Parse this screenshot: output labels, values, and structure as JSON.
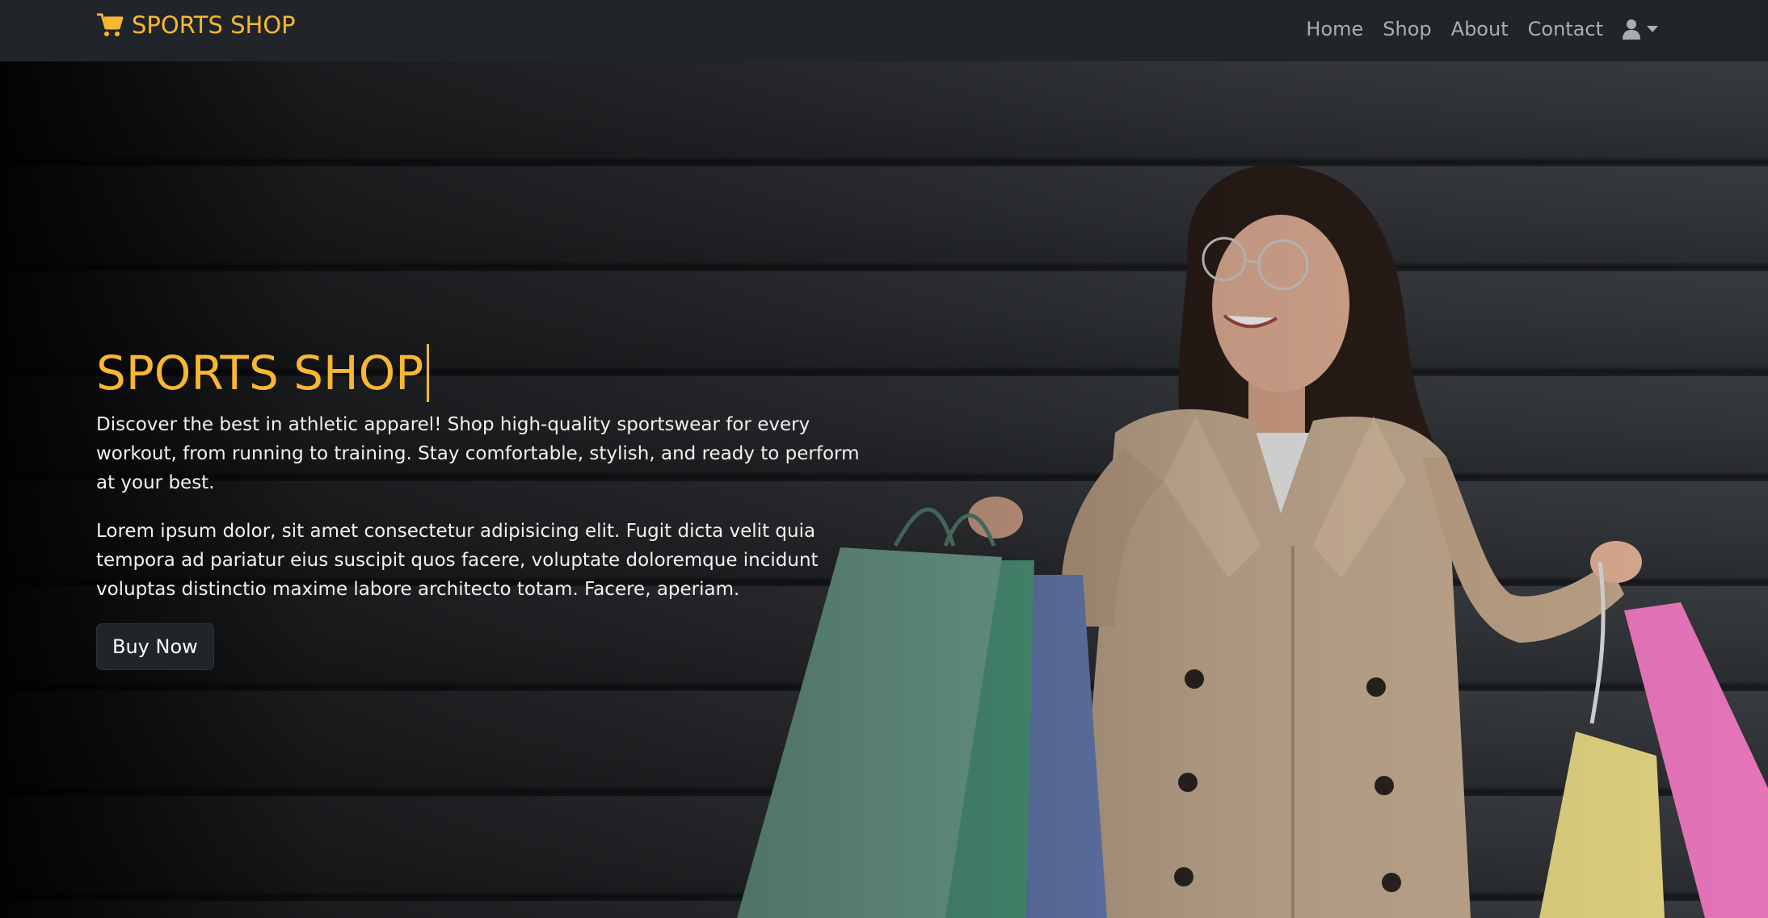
{
  "navbar": {
    "brand": "SPORTS SHOP",
    "links": [
      "Home",
      "Shop",
      "About",
      "Contact"
    ],
    "brand_color": "#f7b731",
    "icons": {
      "brand": "cart-icon",
      "user": "user-icon",
      "caret": "caret-down-icon"
    }
  },
  "hero": {
    "title": "SPORTS SHOP",
    "description": "Discover the best in athletic apparel! Shop high-quality sportswear for every workout, from running to training. Stay comfortable, stylish, and ready to perform at your best.",
    "paragraph": "Lorem ipsum dolor, sit amet consectetur adipisicing elit. Fugit dicta velit quia tempora ad pariatur eius suscipit quos facere, voluptate doloremque incidunt voluptas distinctio maxime labore architecto totam. Facere, aperiam.",
    "button": "Buy Now",
    "title_color": "#f7b731"
  }
}
